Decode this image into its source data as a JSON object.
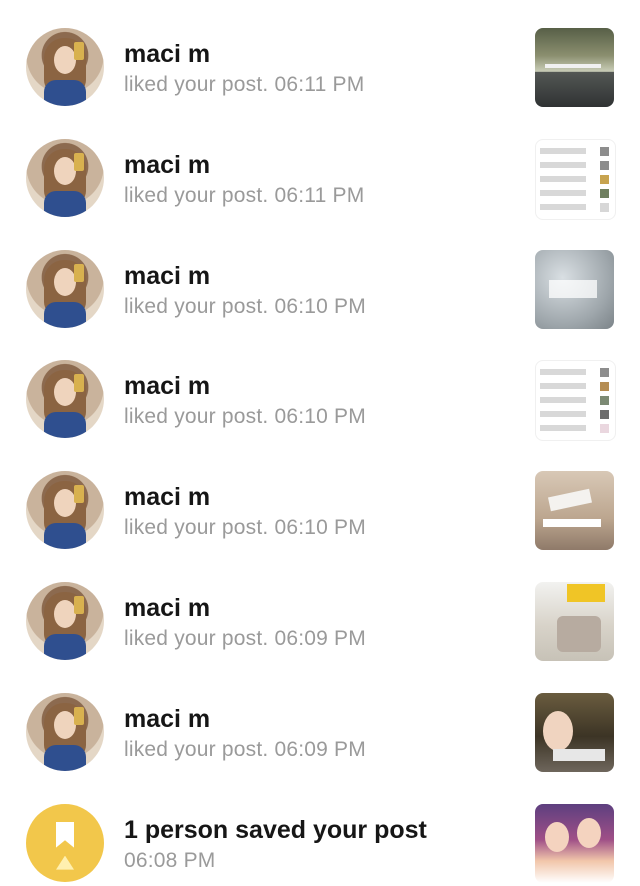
{
  "notifications": [
    {
      "name": "maci m",
      "subtitle": "liked your post. 06:11 PM",
      "thumbnail": "dark-photo"
    },
    {
      "name": "maci m",
      "subtitle": "liked your post. 06:11 PM",
      "thumbnail": "list-screenshot"
    },
    {
      "name": "maci m",
      "subtitle": "liked your post. 06:10 PM",
      "thumbnail": "snow-photo"
    },
    {
      "name": "maci m",
      "subtitle": "liked your post. 06:10 PM",
      "thumbnail": "list-screenshot"
    },
    {
      "name": "maci m",
      "subtitle": "liked your post. 06:10 PM",
      "thumbnail": "product-photo"
    },
    {
      "name": "maci m",
      "subtitle": "liked your post. 06:09 PM",
      "thumbnail": "bag-photo"
    },
    {
      "name": "maci m",
      "subtitle": "liked your post. 06:09 PM",
      "thumbnail": "video-thumb"
    },
    {
      "name": "1 person saved your post",
      "subtitle": "06:08 PM",
      "thumbnail": "people-photo"
    }
  ],
  "colors": {
    "background": "#ffffff",
    "name_text": "#161616",
    "subtitle_text": "#9a9a9a",
    "saved_badge": "#f2c74b"
  }
}
